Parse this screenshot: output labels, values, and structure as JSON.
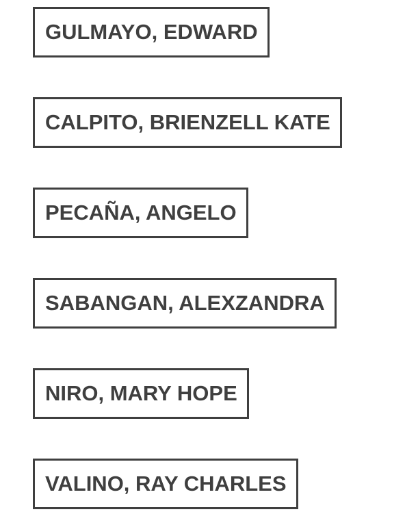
{
  "names": [
    "GULMAYO, EDWARD",
    "CALPITO, BRIENZELL KATE",
    "PECAÑA, ANGELO",
    "SABANGAN, ALEXZANDRA",
    "NIRO, MARY HOPE",
    "VALINO, RAY CHARLES"
  ],
  "colors": {
    "text": "#3f3f3f",
    "border": "#3f3f3f",
    "background": "#ffffff"
  }
}
